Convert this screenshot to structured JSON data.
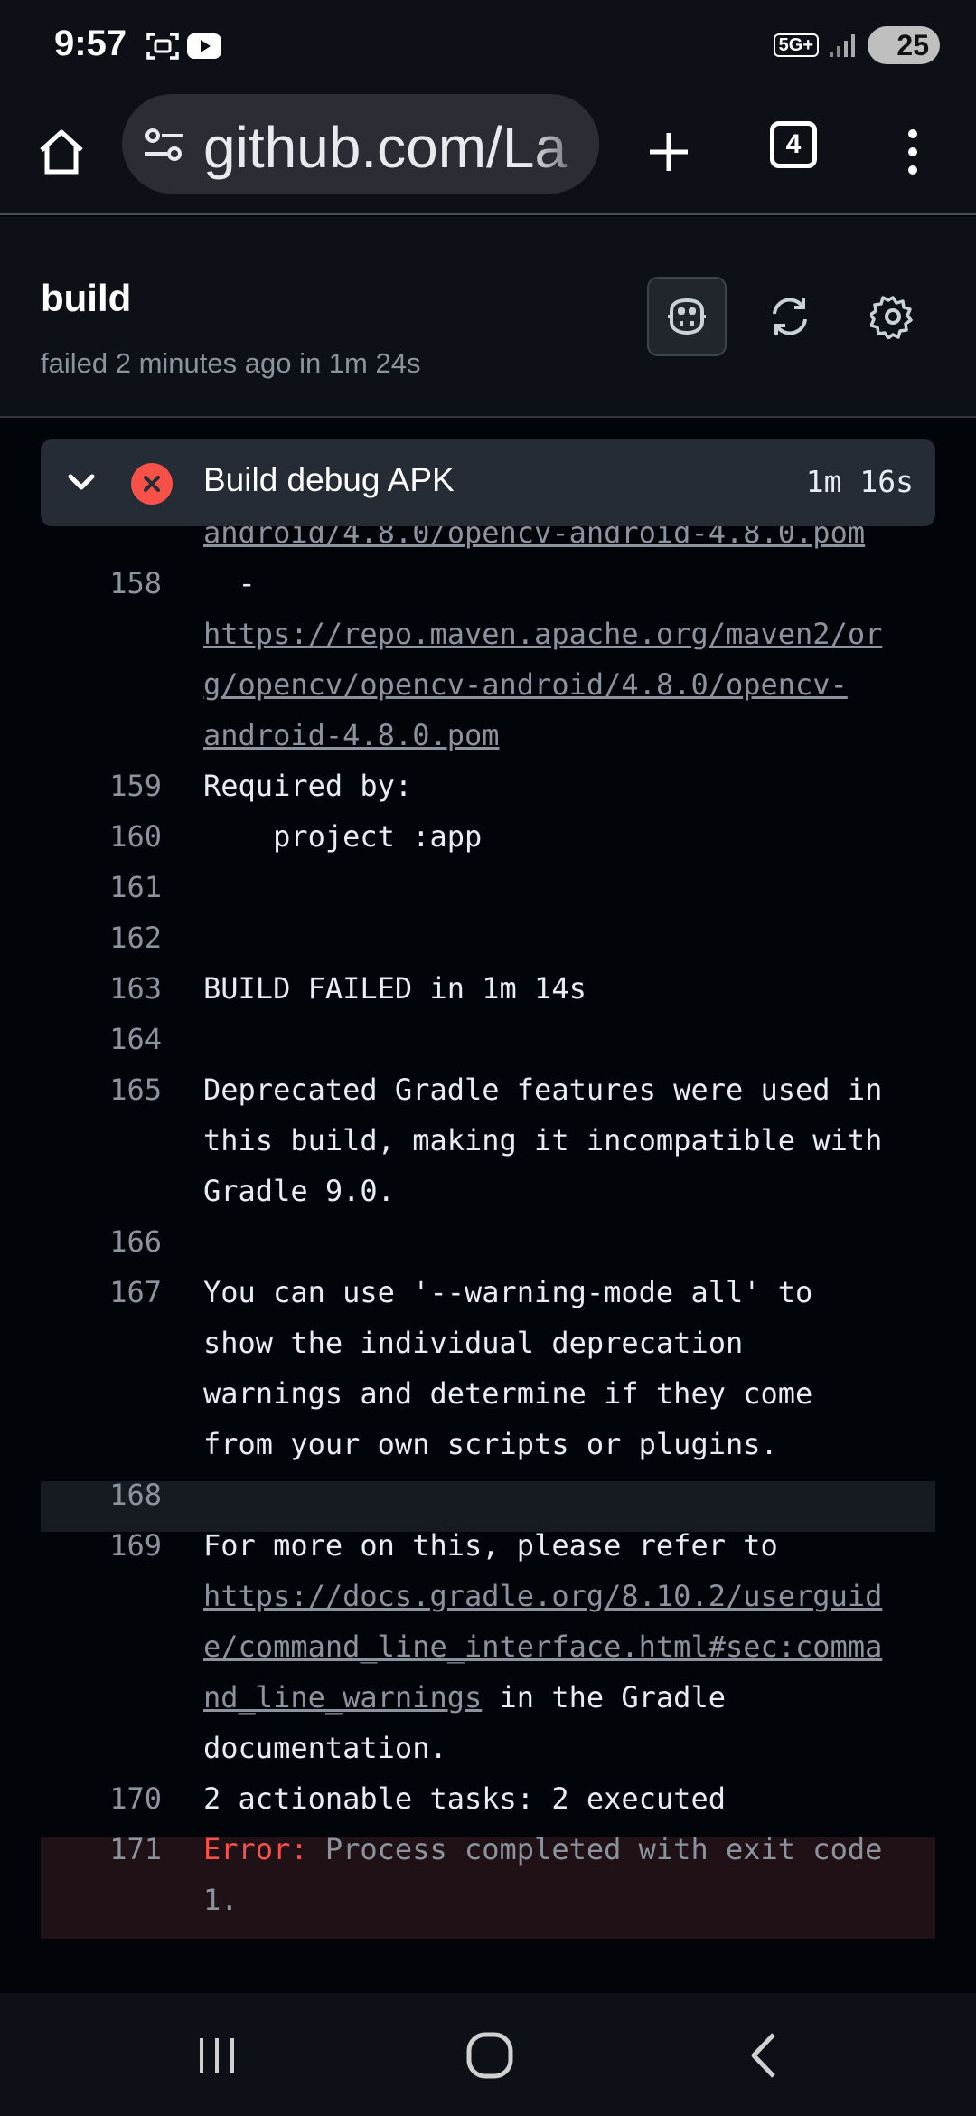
{
  "status_bar": {
    "time": "9:57",
    "network": "5G+",
    "battery": "25",
    "icons": [
      "screenshot-icon",
      "youtube-icon",
      "signal-icon",
      "battery-icon"
    ]
  },
  "browser": {
    "url": "github.com/La",
    "tab_count": "4",
    "icons": [
      "home-icon",
      "site-settings-icon",
      "new-tab-icon",
      "more-options-icon"
    ]
  },
  "job": {
    "title": "build",
    "subtitle": "failed 2 minutes ago in 1m 24s",
    "icons": [
      "copilot-icon",
      "refresh-icon",
      "settings-icon"
    ]
  },
  "step": {
    "title": "Build debug APK",
    "duration": "1m 16s",
    "status": "failed"
  },
  "log": {
    "partial_line": "android/4.8.0/opencv-android-4.8.0.pom",
    "l158": {
      "num": "158",
      "dash": "  -",
      "url_1": "https://repo.maven.apache.org/maven2/or",
      "url_2": "g/opencv/opencv-android/4.8.0/opencv-",
      "url_3": "android-4.8.0.pom"
    },
    "l159": {
      "num": "159",
      "text": "Required by:"
    },
    "l160": {
      "num": "160",
      "text": "    project :app"
    },
    "l161": {
      "num": "161",
      "text": ""
    },
    "l162": {
      "num": "162",
      "text": ""
    },
    "l163": {
      "num": "163",
      "text": "BUILD FAILED in 1m 14s"
    },
    "l164": {
      "num": "164",
      "text": ""
    },
    "l165": {
      "num": "165",
      "text_1": "Deprecated Gradle features were used in",
      "text_2": "this build, making it incompatible with",
      "text_3": "Gradle 9.0."
    },
    "l166": {
      "num": "166",
      "text": ""
    },
    "l167": {
      "num": "167",
      "text_1": "You can use '--warning-mode all' to",
      "text_2": "show the individual deprecation",
      "text_3": "warnings and determine if they come",
      "text_4": "from your own scripts or plugins."
    },
    "l168": {
      "num": "168",
      "text": ""
    },
    "l169": {
      "num": "169",
      "text_1": "For more on this, please refer to",
      "url_1": "https://docs.gradle.org/8.10.2/userguid",
      "url_2": "e/command_line_interface.html#sec:comma",
      "url_3": "nd_line_warnings",
      "text_after": " in the Gradle",
      "text_4": "documentation."
    },
    "l170": {
      "num": "170",
      "text": "2 actionable tasks: 2 executed"
    },
    "l171": {
      "num": "171",
      "error_label": "Error:",
      "text_1": " Process completed with exit code",
      "text_2": "1."
    }
  },
  "colors": {
    "background": "#010409",
    "header": "#0d1117",
    "step_header": "#262c36",
    "error_red": "#f85149",
    "muted": "#8b949e"
  }
}
